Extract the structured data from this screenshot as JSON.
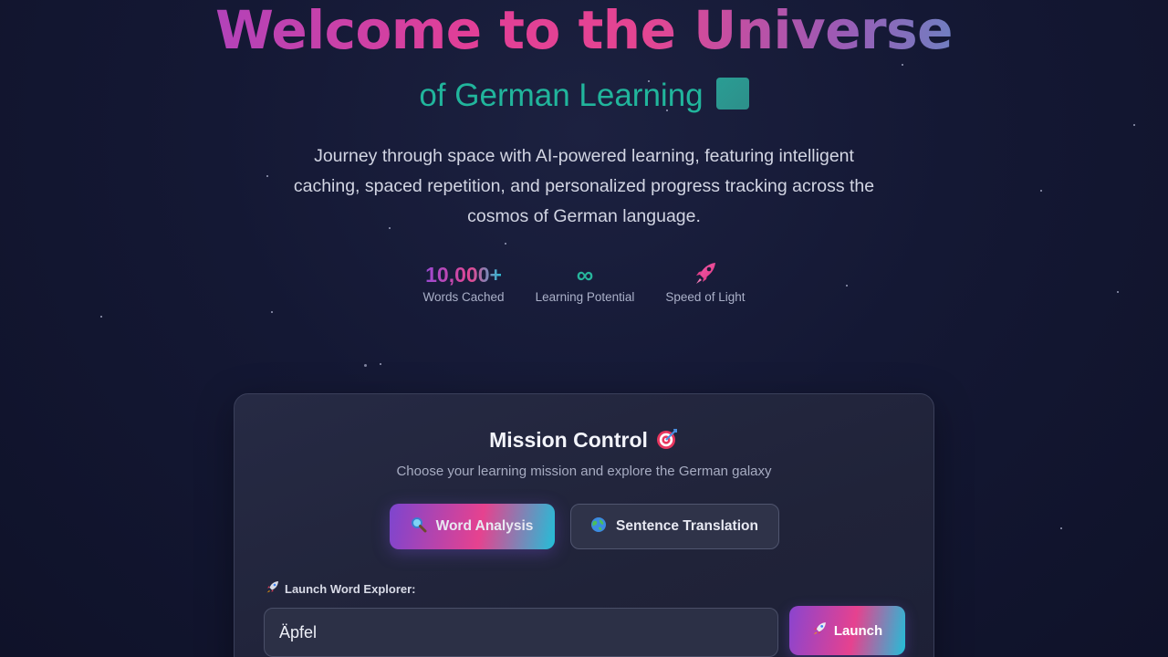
{
  "hero": {
    "title": "Welcome to the Universe",
    "subtitle": "of German Learning",
    "description": "Journey through space with AI-powered learning, featuring intelligent caching, spaced repetition, and personalized progress tracking across the cosmos of German language."
  },
  "stats": [
    {
      "value": "10,000+",
      "label": "Words Cached"
    },
    {
      "value": "∞",
      "label": "Learning Potential"
    },
    {
      "value_icon": "rocket-icon",
      "label": "Speed of Light"
    }
  ],
  "mission": {
    "title": "Mission Control",
    "title_icon": "target-icon",
    "description": "Choose your learning mission and explore the German galaxy",
    "tabs": [
      {
        "label": "Word Analysis",
        "icon": "magnifier-icon",
        "active": true
      },
      {
        "label": "Sentence Translation",
        "icon": "globe-icon",
        "active": false
      }
    ],
    "field_label": "Launch Word Explorer:",
    "field_icon": "rocket-icon",
    "input_value": "Äpfel",
    "launch_label": "Launch"
  },
  "colors": {
    "accent_purple": "#8b46d6",
    "accent_pink": "#e6428f",
    "accent_cyan": "#22bfd8",
    "accent_teal": "#21b59c"
  }
}
